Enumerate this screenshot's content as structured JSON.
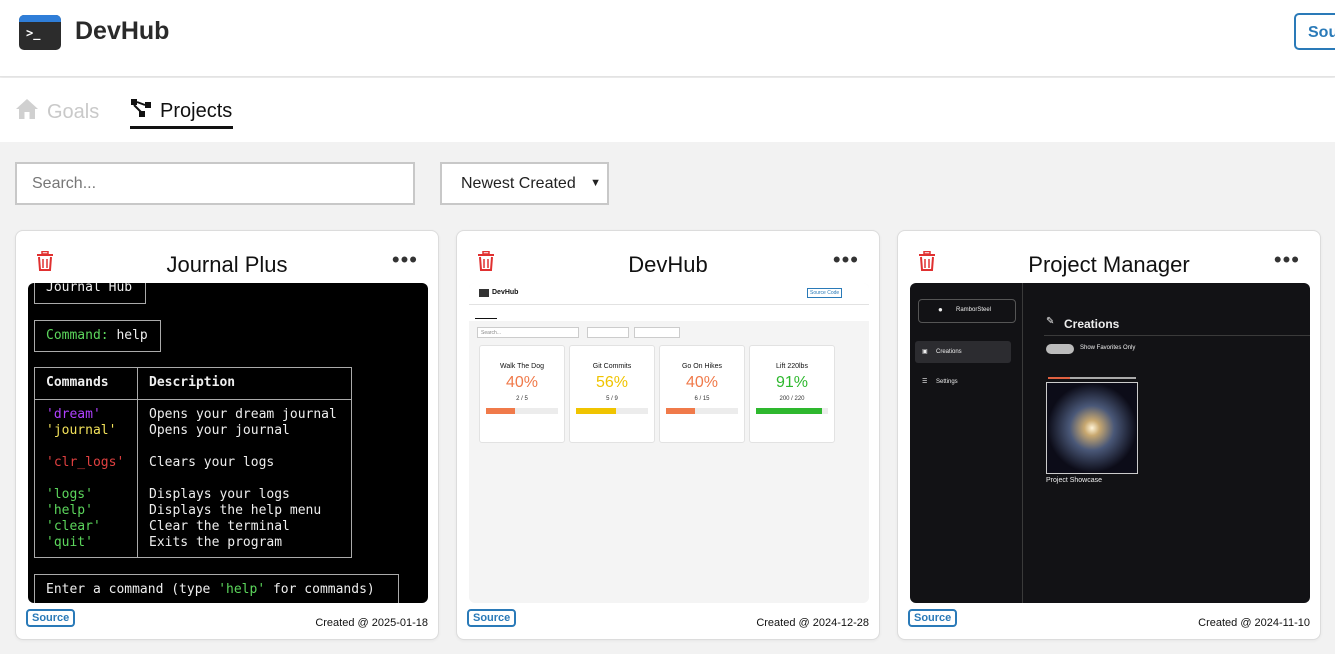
{
  "header": {
    "app_title": "DevHub",
    "logo_prompt": ">_",
    "source_label": "Sou"
  },
  "tabs": [
    {
      "label": "Goals",
      "active": false
    },
    {
      "label": "Projects",
      "active": true
    }
  ],
  "search": {
    "placeholder": "Search..."
  },
  "sort": {
    "selected": "Newest Created"
  },
  "colors": {
    "accent": "#2a7ab8",
    "trash": "#e03030",
    "active_tab": "#111111",
    "inactive_tab": "#c9c9c9"
  },
  "cards": [
    {
      "title": "Journal Plus",
      "source_label": "Source",
      "created": "Created @ 2025-01-18",
      "preview": {
        "hub_title": "Journal Hub",
        "command_label": "Command:",
        "command_value": "help",
        "table_headers": [
          "Commands",
          "Description"
        ],
        "rows": [
          {
            "cmd": "'dream'",
            "desc": "Opens your dream journal"
          },
          {
            "cmd": "'journal'",
            "desc": "Opens your journal"
          },
          {
            "cmd": "'clr_logs'",
            "desc": "Clears your logs"
          },
          {
            "cmd": "'logs'",
            "desc": "Displays your logs"
          },
          {
            "cmd": "'help'",
            "desc": "Displays the help menu"
          },
          {
            "cmd": "'clear'",
            "desc": "Clear the terminal"
          },
          {
            "cmd": "'quit'",
            "desc": "Exits the program"
          }
        ],
        "prompt_before": "Enter a command (type ",
        "prompt_help": "'help'",
        "prompt_after": " for commands)"
      }
    },
    {
      "title": "DevHub",
      "source_label": "Source",
      "created": "Created @ 2024-12-28",
      "preview": {
        "app_title": "DevHub",
        "source_label": "Source Code",
        "search_placeholder": "Search...",
        "goals": [
          {
            "title": "Walk The Dog",
            "percent": "40%",
            "value": 0.4,
            "color": "#f07a4a",
            "count": "2 / 5"
          },
          {
            "title": "Git Commits",
            "percent": "56%",
            "value": 0.56,
            "color": "#f0c400",
            "count": "5 / 9"
          },
          {
            "title": "Go On Hikes",
            "percent": "40%",
            "value": 0.4,
            "color": "#f07a4a",
            "count": "6 / 15"
          },
          {
            "title": "Lift 220lbs",
            "percent": "91%",
            "value": 0.91,
            "color": "#2eb82e",
            "count": "200 / 220"
          }
        ]
      }
    },
    {
      "title": "Project Manager",
      "source_label": "Source",
      "created": "Created @ 2024-11-10",
      "preview": {
        "username": "RamborSteel",
        "nav": [
          "Creations",
          "Settings"
        ],
        "heading": "Creations",
        "toggle_label": "Show Favorites Only",
        "project_name": "Project Showcase"
      }
    }
  ]
}
